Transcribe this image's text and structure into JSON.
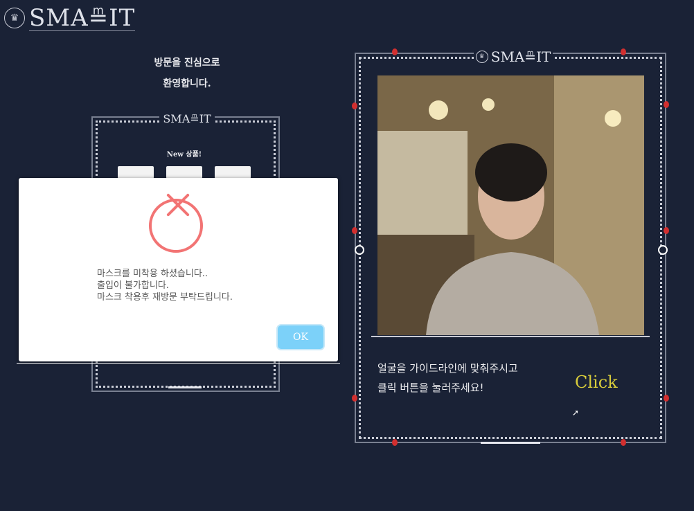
{
  "brand": {
    "logo_text": "SMA≞IT",
    "crest_icon": "♛"
  },
  "left_panel": {
    "welcome": [
      "방문을 진심으로",
      "환영합니다."
    ],
    "inner_logo": "SMA≞IT",
    "new_label": "New 상품!"
  },
  "right_panel": {
    "logo": "SMA≞IT",
    "guide_lines": [
      "얼굴을 가이드라인에 맞춰주시고",
      "클릭 버튼을 눌러주세요!"
    ],
    "click_label": "Click"
  },
  "modal": {
    "message_lines": [
      "마스크를 미착용 하셨습니다..",
      "출입이 불가합니다.",
      "마스크 착용후 재방문 부탁드립니다."
    ],
    "ok_label": "OK",
    "error_color": "#f27474",
    "ok_color": "#7cd1f9"
  }
}
